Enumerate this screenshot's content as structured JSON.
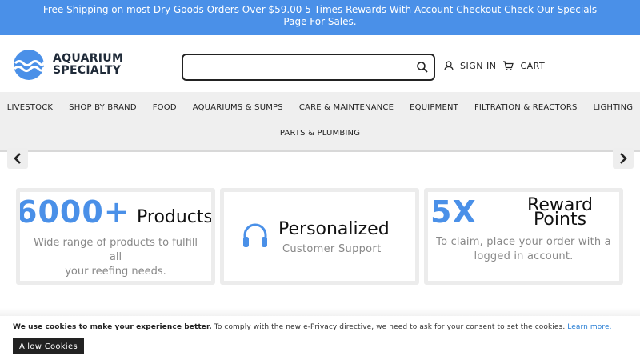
{
  "promo": {
    "text": "Free Shipping on most Dry Goods Orders Over $59.00 5 Times Rewards With Account Checkout Check Our Specials Page For Sales."
  },
  "header": {
    "logo_line1": "AQUARIUM",
    "logo_line2": "SPECIALTY",
    "search_value": "",
    "search_placeholder": "",
    "sign_in": "SIGN IN",
    "cart": "CART",
    "brand_color": "#4a90e8"
  },
  "nav": {
    "row1": [
      "LIVESTOCK",
      "SHOP BY BRAND",
      "FOOD",
      "AQUARIUMS & SUMPS",
      "CARE & MAINTENANCE",
      "EQUIPMENT",
      "FILTRATION & REACTORS",
      "LIGHTING"
    ],
    "row2": [
      "PARTS & PLUMBING"
    ]
  },
  "cards": {
    "products": {
      "big": "6000+",
      "word": "Products",
      "desc_line1": "Wide range of products to fulfill",
      "desc_line2": "all",
      "desc_line3": "your reefing needs."
    },
    "support": {
      "icon": "headphones-icon",
      "word": "Personalized",
      "sub": "Customer Support"
    },
    "rewards": {
      "big": "5X",
      "word_line1": "Reward",
      "word_line2": "Points",
      "desc_line1": "To claim, place your order with a",
      "desc_line2": "logged in account."
    }
  },
  "cookie": {
    "bold": "We use cookies to make your experience better.",
    "text": " To comply with the new e-Privacy directive, we need to ask for your consent to set the cookies. ",
    "link": "Learn more.",
    "button": "Allow Cookies"
  }
}
